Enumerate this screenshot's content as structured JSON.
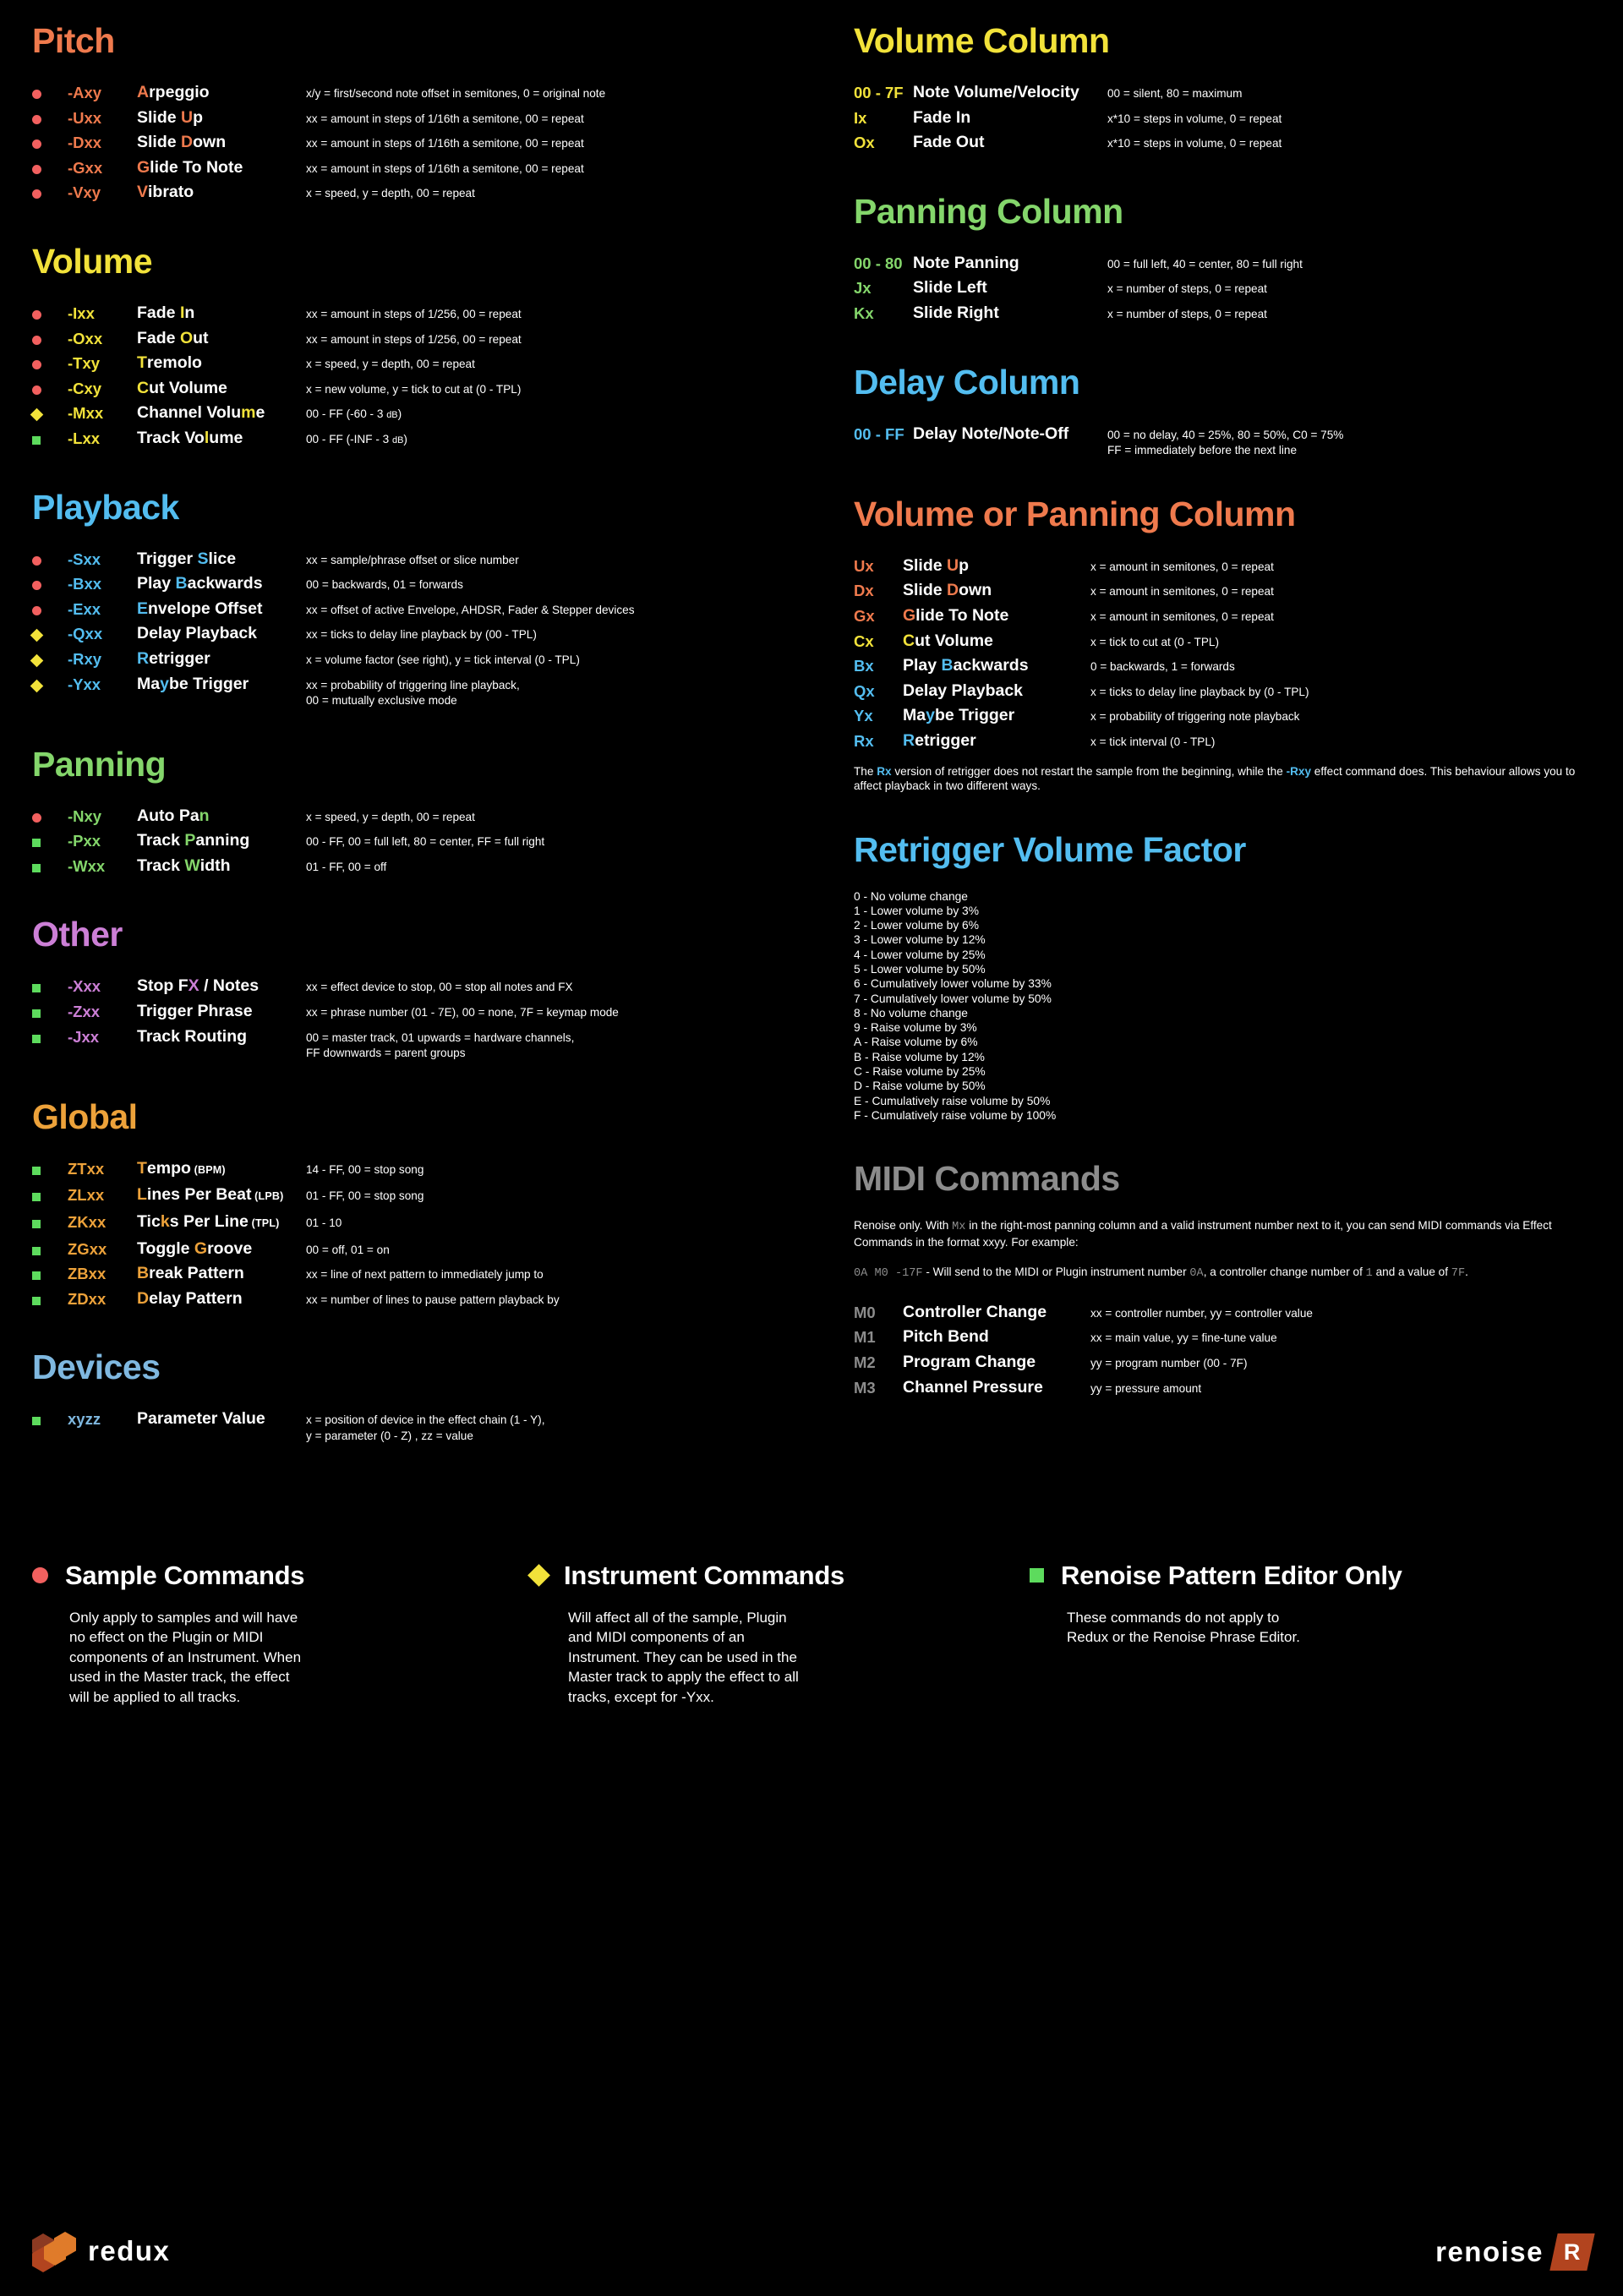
{
  "colors": {
    "pitch": "#ef7a4d",
    "volume": "#f2e23a",
    "playback": "#53bdf0",
    "panning": "#84d66b",
    "other": "#cc7fd6",
    "global": "#eda23a",
    "devices": "#7fb8e0",
    "volume_column": "#f2e23a",
    "panning_column": "#84d66b",
    "delay_column": "#53bdf0",
    "vol_or_pan_column": "#ef7a4d",
    "retrigger_factor": "#53bdf0",
    "midi": "#8c8c8c",
    "marker_sample": "#f2605f",
    "marker_instrument": "#f2e23a",
    "marker_renoise": "#5ddb5d"
  },
  "left": {
    "pitch": {
      "title": "Pitch",
      "rows": [
        {
          "marker": "circle",
          "code": "-Axy",
          "name_hl": "A",
          "name_rest": "rpeggio",
          "name_pre": "",
          "desc": "x/y = first/second note offset in semitones, 0 = original note"
        },
        {
          "marker": "circle",
          "code": "-Uxx",
          "name_pre": "Slide ",
          "name_hl": "U",
          "name_rest": "p",
          "desc": "xx = amount in steps of 1/16th a semitone, 00 = repeat"
        },
        {
          "marker": "circle",
          "code": "-Dxx",
          "name_pre": "Slide ",
          "name_hl": "D",
          "name_rest": "own",
          "desc": "xx = amount in steps of 1/16th a semitone, 00 = repeat"
        },
        {
          "marker": "circle",
          "code": "-Gxx",
          "name_pre": "",
          "name_hl": "G",
          "name_rest": "lide To Note",
          "desc": "xx = amount in steps of 1/16th a semitone, 00 = repeat"
        },
        {
          "marker": "circle",
          "code": "-Vxy",
          "name_pre": "",
          "name_hl": "V",
          "name_rest": "ibrato",
          "desc": "x = speed, y = depth, 00 = repeat"
        }
      ]
    },
    "volume": {
      "title": "Volume",
      "rows": [
        {
          "marker": "circle",
          "code": "-Ixx",
          "name_pre": "Fade ",
          "name_hl": "I",
          "name_rest": "n",
          "desc": "xx = amount in steps of 1/256, 00 = repeat"
        },
        {
          "marker": "circle",
          "code": "-Oxx",
          "name_pre": "Fade ",
          "name_hl": "O",
          "name_rest": "ut",
          "desc": "xx = amount in steps of 1/256, 00 = repeat"
        },
        {
          "marker": "circle",
          "code": "-Txy",
          "name_pre": "",
          "name_hl": "T",
          "name_rest": "remolo",
          "desc": "x = speed, y = depth, 00 = repeat"
        },
        {
          "marker": "circle",
          "code": "-Cxy",
          "name_pre": "",
          "name_hl": "C",
          "name_rest": "ut Volume",
          "desc": "x = new volume, y = tick to cut at (0 - TPL)"
        },
        {
          "marker": "diamond",
          "code": "-Mxx",
          "name_pre": "Channel Volu",
          "name_hl": "m",
          "name_rest": "e",
          "desc": "00 - FF (-60 - 3 dB)",
          "desc_sub": "dB"
        },
        {
          "marker": "square",
          "code": "-Lxx",
          "name_pre": "Track Vo",
          "name_hl": "l",
          "name_rest": "ume",
          "desc": "00 - FF (-INF - 3 dB)",
          "desc_sub": "dB"
        }
      ]
    },
    "playback": {
      "title": "Playback",
      "rows": [
        {
          "marker": "circle",
          "code": "-Sxx",
          "name_pre": "Trigger ",
          "name_hl": "S",
          "name_rest": "lice",
          "desc": "xx = sample/phrase offset or slice number"
        },
        {
          "marker": "circle",
          "code": "-Bxx",
          "name_pre": "Play ",
          "name_hl": "B",
          "name_rest": "ackwards",
          "desc": "00 = backwards, 01 = forwards"
        },
        {
          "marker": "circle",
          "code": "-Exx",
          "name_pre": "",
          "name_hl": "E",
          "name_rest": "nvelope Offset",
          "desc": "xx = offset of active Envelope, AHDSR, Fader & Stepper devices"
        },
        {
          "marker": "diamond",
          "code": "-Qxx",
          "name_pre": "Delay Playback",
          "name_hl": "",
          "name_rest": "",
          "desc": "xx = ticks to delay line playback by (00 - TPL)"
        },
        {
          "marker": "diamond",
          "code": "-Rxy",
          "name_pre": "",
          "name_hl": "R",
          "name_rest": "etrigger",
          "desc": "x = volume factor (see right), y = tick interval (0 - TPL)"
        },
        {
          "marker": "diamond",
          "code": "-Yxx",
          "name_pre": "Ma",
          "name_hl": "y",
          "name_rest": "be Trigger",
          "desc": "xx = probability of triggering line playback,",
          "desc2": "00 = mutually exclusive mode"
        }
      ]
    },
    "panning": {
      "title": "Panning",
      "rows": [
        {
          "marker": "circle",
          "code": "-Nxy",
          "name_pre": "Auto Pa",
          "name_hl": "n",
          "name_rest": "",
          "desc": "x = speed, y = depth, 00 = repeat"
        },
        {
          "marker": "square",
          "code": "-Pxx",
          "name_pre": "Track ",
          "name_hl": "P",
          "name_rest": "anning",
          "desc": "00 - FF, 00 = full left, 80 = center, FF = full right"
        },
        {
          "marker": "square",
          "code": "-Wxx",
          "name_pre": "Track ",
          "name_hl": "W",
          "name_rest": "idth",
          "desc": "01 - FF, 00 = off"
        }
      ]
    },
    "other": {
      "title": "Other",
      "rows": [
        {
          "marker": "square",
          "code": "-Xxx",
          "name_pre": "Stop F",
          "name_hl": "X",
          "name_rest": " / Notes",
          "desc": "xx = effect device to stop, 00 = stop all notes and FX"
        },
        {
          "marker": "square",
          "code": "-Zxx",
          "name_pre": "Trigger Phrase",
          "name_hl": "",
          "name_rest": "",
          "desc": "xx = phrase number (01 - 7E), 00 = none, 7F = keymap mode"
        },
        {
          "marker": "square",
          "code": "-Jxx",
          "name_pre": "Track Routing",
          "name_hl": "",
          "name_rest": "",
          "desc": "00 = master track, 01 upwards = hardware channels,",
          "desc2": "FF downwards = parent groups"
        }
      ]
    },
    "global": {
      "title": "Global",
      "rows": [
        {
          "marker": "square",
          "code": "ZTxx",
          "name_pre": "",
          "name_hl": "T",
          "name_rest": "empo",
          "name_sub": "(BPM)",
          "desc": "14 - FF, 00 = stop song"
        },
        {
          "marker": "square",
          "code": "ZLxx",
          "name_pre": "",
          "name_hl": "L",
          "name_rest": "ines Per Beat",
          "name_sub": "(LPB)",
          "desc": "01 - FF, 00 = stop song"
        },
        {
          "marker": "square",
          "code": "ZKxx",
          "name_pre": "Tic",
          "name_hl": "k",
          "name_rest": "s Per Line",
          "name_sub": "(TPL)",
          "desc": "01 - 10"
        },
        {
          "marker": "square",
          "code": "ZGxx",
          "name_pre": "Toggle ",
          "name_hl": "G",
          "name_rest": "roove",
          "desc": "00 = off, 01 = on"
        },
        {
          "marker": "square",
          "code": "ZBxx",
          "name_pre": "",
          "name_hl": "B",
          "name_rest": "reak Pattern",
          "desc": "xx = line of next pattern to immediately jump to"
        },
        {
          "marker": "square",
          "code": "ZDxx",
          "name_pre": "",
          "name_hl": "D",
          "name_rest": "elay Pattern",
          "desc": "xx = number of lines to pause pattern playback by"
        }
      ]
    },
    "devices": {
      "title": "Devices",
      "rows": [
        {
          "marker": "square",
          "code": "xyzz",
          "name_pre": "Parameter Value",
          "name_hl": "",
          "name_rest": "",
          "desc": "x = position of device in the effect chain (1 - Y),",
          "desc2": "y = parameter (0 - Z) , zz = value"
        }
      ]
    }
  },
  "right": {
    "volume_column": {
      "title": "Volume Column",
      "rows": [
        {
          "code": "00 - 7F",
          "name": "Note Volume/Velocity",
          "desc": "00 = silent, 80 = maximum"
        },
        {
          "code": "Ix",
          "name": "Fade In",
          "desc": "x*10 = steps in volume, 0 = repeat"
        },
        {
          "code": "Ox",
          "name": "Fade Out",
          "desc": "x*10 = steps in volume, 0 = repeat"
        }
      ]
    },
    "panning_column": {
      "title": "Panning Column",
      "rows": [
        {
          "code": "00 - 80",
          "name": "Note Panning",
          "desc": "00 = full left, 40 = center, 80 = full right"
        },
        {
          "code": "Jx",
          "name": "Slide Left",
          "desc": "x = number of steps, 0 = repeat"
        },
        {
          "code": "Kx",
          "name": "Slide Right",
          "desc": "x = number of steps, 0 = repeat"
        }
      ]
    },
    "delay_column": {
      "title": "Delay Column",
      "rows": [
        {
          "code": "00 - FF",
          "name": "Delay Note/Note-Off",
          "desc": "00 = no delay, 40 = 25%, 80 = 50%, C0 = 75%",
          "desc2": "FF = immediately before the next line"
        }
      ]
    },
    "vol_or_pan_column": {
      "title": "Volume or Panning Column",
      "rows": [
        {
          "code": "Ux",
          "code_color": "#ef7a4d",
          "name_pre": "Slide ",
          "name_hl": "U",
          "name_hl_color": "#ef7a4d",
          "name_rest": "p",
          "desc": "x = amount in semitones, 0 = repeat"
        },
        {
          "code": "Dx",
          "code_color": "#ef7a4d",
          "name_pre": "Slide ",
          "name_hl": "D",
          "name_hl_color": "#ef7a4d",
          "name_rest": "own",
          "desc": "x = amount in semitones, 0 = repeat"
        },
        {
          "code": "Gx",
          "code_color": "#ef7a4d",
          "name_pre": "",
          "name_hl": "G",
          "name_hl_color": "#ef7a4d",
          "name_rest": "lide To Note",
          "desc": "x = amount in semitones, 0 = repeat"
        },
        {
          "code": "Cx",
          "code_color": "#f2e23a",
          "name_pre": "",
          "name_hl": "C",
          "name_hl_color": "#f2e23a",
          "name_rest": "ut Volume",
          "desc": "x = tick to cut at (0 - TPL)"
        },
        {
          "code": "Bx",
          "code_color": "#53bdf0",
          "name_pre": "Play ",
          "name_hl": "B",
          "name_hl_color": "#53bdf0",
          "name_rest": "ackwards",
          "desc": "0 = backwards, 1 = forwards"
        },
        {
          "code": "Qx",
          "code_color": "#53bdf0",
          "name_pre": "Delay Playback",
          "name_hl": "",
          "name_hl_color": "#53bdf0",
          "name_rest": "",
          "desc": "x = ticks to delay line playback by (0 - TPL)"
        },
        {
          "code": "Yx",
          "code_color": "#53bdf0",
          "name_pre": "Ma",
          "name_hl": "y",
          "name_hl_color": "#53bdf0",
          "name_rest": "be Trigger",
          "desc": "x = probability of triggering note playback"
        },
        {
          "code": "Rx",
          "code_color": "#53bdf0",
          "name_pre": "",
          "name_hl": "R",
          "name_hl_color": "#53bdf0",
          "name_rest": "etrigger",
          "desc": "x = tick interval (0 - TPL)"
        }
      ],
      "note_parts": {
        "p1": "The ",
        "hl1": "Rx",
        "p2": " version of retrigger does not restart the sample from the beginning, while the ",
        "hl2": "-Rxy",
        "p3": " effect command does. This behaviour allows you to affect playback in two different ways."
      }
    },
    "retrigger_volume_factor": {
      "title": "Retrigger Volume Factor",
      "items": [
        "0 - No volume change",
        "1 - Lower volume by 3%",
        "2 - Lower volume by 6%",
        "3 - Lower volume by 12%",
        "4 - Lower volume by 25%",
        "5 - Lower volume by 50%",
        "6 - Cumulatively lower volume by 33%",
        "7 - Cumulatively lower volume by 50%",
        "8 - No volume change",
        "9 - Raise volume by 3%",
        "A - Raise volume by 6%",
        "B - Raise volume by 12%",
        "C - Raise volume by 25%",
        "D - Raise volume by 50%",
        "E - Cumulatively raise volume by 50%",
        "F - Cumulatively raise volume by 100%"
      ]
    },
    "midi": {
      "title": "MIDI Commands",
      "intro_parts": {
        "p1": "Renoise only. With ",
        "hl1": "Mx",
        "p2": " in the right-most panning column and a valid instrument number next to it, you can send MIDI commands via Effect Commands in the format xxyy. For example:"
      },
      "example_parts": {
        "code": "0A M0 -17F",
        "p1": " - Will send to the MIDI or Plugin instrument number ",
        "hl1": "0A",
        "p2": ", a controller change number of ",
        "hl2": "1",
        "p3": " and a value of ",
        "hl3": "7F",
        "p4": "."
      },
      "rows": [
        {
          "code": "M0",
          "name": "Controller Change",
          "desc": "xx = controller number, yy = controller value"
        },
        {
          "code": "M1",
          "name": "Pitch Bend",
          "desc": "xx = main value, yy = fine-tune value"
        },
        {
          "code": "M2",
          "name": "Program Change",
          "desc": "yy = program number (00 - 7F)"
        },
        {
          "code": "M3",
          "name": "Channel Pressure",
          "desc": "yy = pressure amount"
        }
      ]
    }
  },
  "legend": [
    {
      "marker": "circle",
      "title": "Sample Commands",
      "body": "Only apply to samples and will have no effect on the Plugin or MIDI components of an Instrument. When used in the Master track, the effect will be applied to all tracks."
    },
    {
      "marker": "diamond",
      "title": "Instrument Commands",
      "body": "Will affect all of the sample, Plugin and MIDI components of an Instrument. They can be used in the Master track to apply the effect to all tracks, except for -Yxx."
    },
    {
      "marker": "square",
      "title": "Renoise Pattern Editor Only",
      "body": "These commands do not apply to Redux or the Renoise Phrase Editor."
    }
  ],
  "logos": {
    "redux": "redux",
    "renoise": "renoise",
    "renoise_badge": "R"
  }
}
